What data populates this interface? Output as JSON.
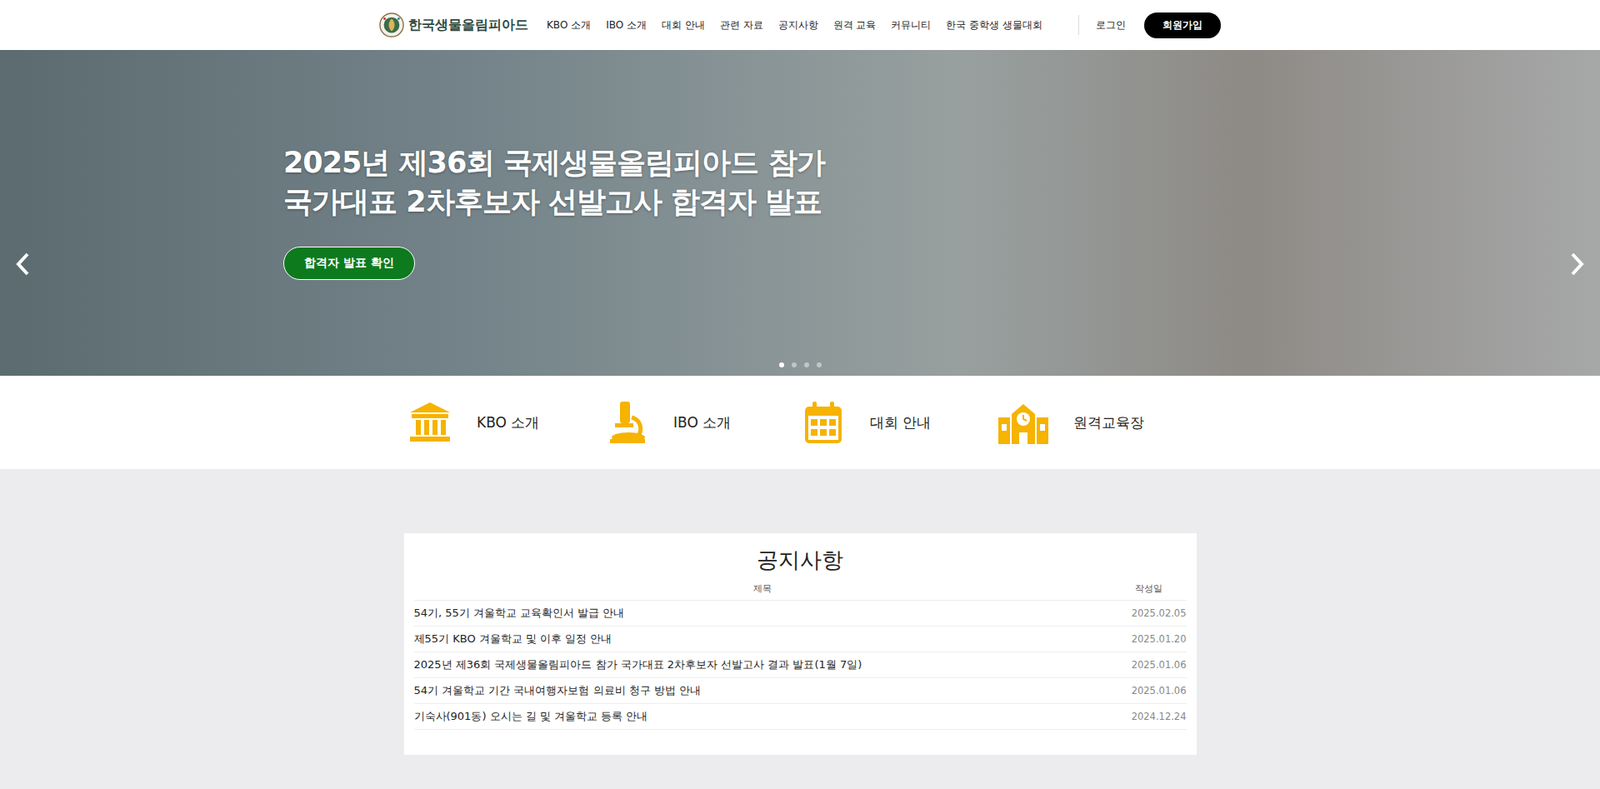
{
  "header": {
    "logo": "한국생물올림피아드",
    "nav": [
      "KBO 소개",
      "IBO 소개",
      "대회 안내",
      "관련 자료",
      "공지사항",
      "원격 교육",
      "커뮤니티",
      "한국 중학생 생물대회"
    ],
    "login": "로그인",
    "signup": "회원가입"
  },
  "hero": {
    "title": [
      "2025년 제36회 국제생물올림피아드 참가",
      "국가대표 2차후보자 선발고사 합격자 발표"
    ],
    "button": "합격자 발표 확인",
    "dots": [
      {
        "selected": true
      },
      {
        "selected": false
      },
      {
        "selected": false
      },
      {
        "selected": false
      }
    ]
  },
  "quick_links": [
    {
      "label": "KBO 소개"
    },
    {
      "label": "IBO 소개"
    },
    {
      "label": "대회 안내"
    },
    {
      "label": "원격교육장"
    }
  ],
  "notices": {
    "title": "공지사항",
    "columns": [
      "제목",
      "작성일"
    ],
    "rows": [
      {
        "title": "54기, 55기 겨울학교 교육확인서 발급 안내",
        "date": "2025.02.05"
      },
      {
        "title": "제55기 KBO 겨울학교 및 이후 일정 안내",
        "date": "2025.01.20"
      },
      {
        "title": "2025년 제36회 국제생물올림피아드 참가 국가대표 2차후보자 선발고사 결과 발표(1월 7일)",
        "date": "2025.01.06"
      },
      {
        "title": "54기 겨울학교 기간 국내여행자보험 의료비 청구 방법 안내",
        "date": "2025.01.06"
      },
      {
        "title": "기숙사(901동) 오시는 길 및 겨울학교 등록 안내",
        "date": "2024.12.24"
      }
    ]
  }
}
